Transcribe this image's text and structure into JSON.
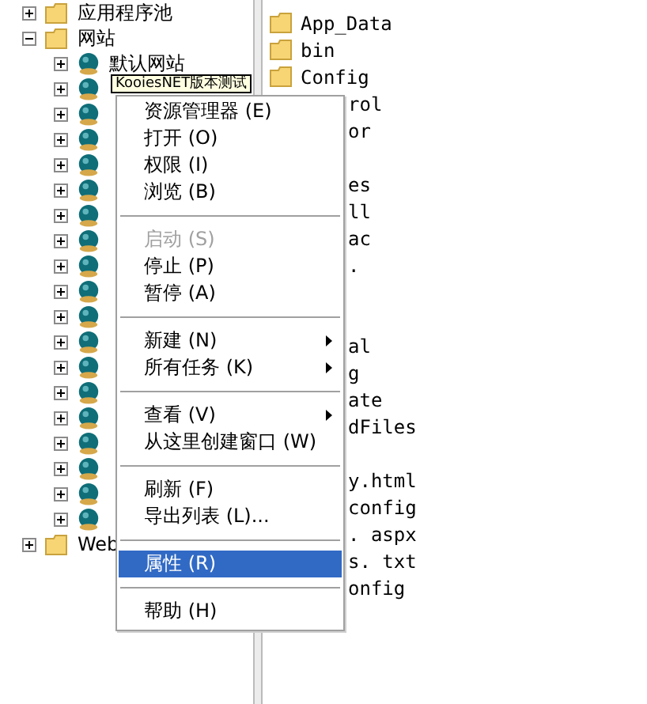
{
  "tree": [
    {
      "label": "应用程序池",
      "kind": "folder",
      "expanded": false
    },
    {
      "label": "网站",
      "kind": "folder",
      "expanded": true,
      "children": [
        {
          "label": "默认网站",
          "kind": "site",
          "expanded": false
        },
        {
          "kind": "site",
          "expanded": false
        },
        {
          "kind": "site",
          "expanded": false
        },
        {
          "kind": "site",
          "expanded": false
        },
        {
          "kind": "site",
          "expanded": false
        },
        {
          "kind": "site",
          "expanded": false
        },
        {
          "kind": "site",
          "expanded": false
        },
        {
          "kind": "site",
          "expanded": false
        },
        {
          "kind": "site",
          "expanded": false
        },
        {
          "kind": "site",
          "expanded": false
        },
        {
          "kind": "site",
          "expanded": false
        },
        {
          "kind": "site",
          "expanded": false
        },
        {
          "kind": "site",
          "expanded": false
        },
        {
          "kind": "site",
          "expanded": false
        },
        {
          "kind": "site",
          "expanded": false
        },
        {
          "kind": "site",
          "expanded": false
        },
        {
          "kind": "site",
          "expanded": false
        },
        {
          "kind": "site",
          "expanded": false
        },
        {
          "kind": "site",
          "expanded": false
        }
      ]
    },
    {
      "label": "Web",
      "kind": "folder",
      "expanded": false
    }
  ],
  "tooltip": "KooiesNET版本测试",
  "files": [
    {
      "kind": "full",
      "name": "App_Data"
    },
    {
      "kind": "full",
      "name": "bin"
    },
    {
      "kind": "full",
      "name": "Config"
    },
    {
      "kind": "covered",
      "name": "rol"
    },
    {
      "kind": "covered",
      "name": "or"
    },
    {
      "kind": "hidden"
    },
    {
      "kind": "covered",
      "name": "es"
    },
    {
      "kind": "covered",
      "name": "ll"
    },
    {
      "kind": "covered",
      "name": "ac"
    },
    {
      "kind": "covered",
      "name": "."
    },
    {
      "kind": "hidden"
    },
    {
      "kind": "hidden"
    },
    {
      "kind": "covered",
      "name": "al"
    },
    {
      "kind": "covered",
      "name": "g"
    },
    {
      "kind": "covered",
      "name": "ate"
    },
    {
      "kind": "covered",
      "name": "dFiles"
    },
    {
      "kind": "hidden"
    },
    {
      "kind": "covered",
      "name": "y.html"
    },
    {
      "kind": "covered",
      "name": "config"
    },
    {
      "kind": "covered",
      "name": ". aspx"
    },
    {
      "kind": "covered",
      "name": "s. txt"
    },
    {
      "kind": "covered",
      "name": "onfig"
    }
  ],
  "menu": [
    {
      "kind": "item",
      "label": "资源管理器 (E)",
      "disabled": false,
      "submenu": false,
      "selected": false
    },
    {
      "kind": "item",
      "label": "打开 (O)",
      "disabled": false,
      "submenu": false,
      "selected": false
    },
    {
      "kind": "item",
      "label": "权限 (I)",
      "disabled": false,
      "submenu": false,
      "selected": false
    },
    {
      "kind": "item",
      "label": "浏览 (B)",
      "disabled": false,
      "submenu": false,
      "selected": false
    },
    {
      "kind": "separator"
    },
    {
      "kind": "item",
      "label": "启动 (S)",
      "disabled": true,
      "submenu": false,
      "selected": false
    },
    {
      "kind": "item",
      "label": "停止 (P)",
      "disabled": false,
      "submenu": false,
      "selected": false
    },
    {
      "kind": "item",
      "label": "暂停 (A)",
      "disabled": false,
      "submenu": false,
      "selected": false
    },
    {
      "kind": "separator"
    },
    {
      "kind": "item",
      "label": "新建 (N)",
      "disabled": false,
      "submenu": true,
      "selected": false
    },
    {
      "kind": "item",
      "label": "所有任务 (K)",
      "disabled": false,
      "submenu": true,
      "selected": false
    },
    {
      "kind": "separator"
    },
    {
      "kind": "item",
      "label": "查看 (V)",
      "disabled": false,
      "submenu": true,
      "selected": false
    },
    {
      "kind": "item",
      "label": "从这里创建窗口 (W)",
      "disabled": false,
      "submenu": false,
      "selected": false
    },
    {
      "kind": "separator"
    },
    {
      "kind": "item",
      "label": "刷新 (F)",
      "disabled": false,
      "submenu": false,
      "selected": false
    },
    {
      "kind": "item",
      "label": "导出列表 (L)...",
      "disabled": false,
      "submenu": false,
      "selected": false
    },
    {
      "kind": "separator"
    },
    {
      "kind": "item",
      "label": "属性 (R)",
      "disabled": false,
      "submenu": false,
      "selected": true
    },
    {
      "kind": "separator"
    },
    {
      "kind": "item",
      "label": "帮助 (H)",
      "disabled": false,
      "submenu": false,
      "selected": false
    }
  ]
}
